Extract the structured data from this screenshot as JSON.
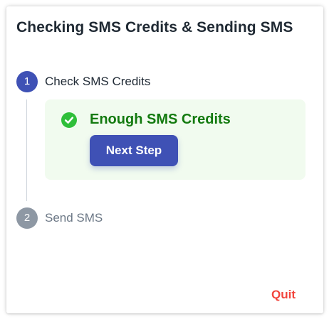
{
  "dialog": {
    "title": "Checking SMS Credits & Sending SMS"
  },
  "steps": [
    {
      "number": "1",
      "label": "Check SMS Credits",
      "state": "active"
    },
    {
      "number": "2",
      "label": "Send SMS",
      "state": "pending"
    }
  ],
  "status": {
    "icon": "check-circle-icon",
    "message": "Enough SMS Credits"
  },
  "actions": {
    "next_label": "Next Step",
    "quit_label": "Quit"
  },
  "colors": {
    "primary": "#3f51b5",
    "success": "#137a0f",
    "success_icon": "#2fbf3a",
    "success_background": "#f1fbef",
    "pending_step": "#8e98a4",
    "danger": "#f2453d"
  }
}
